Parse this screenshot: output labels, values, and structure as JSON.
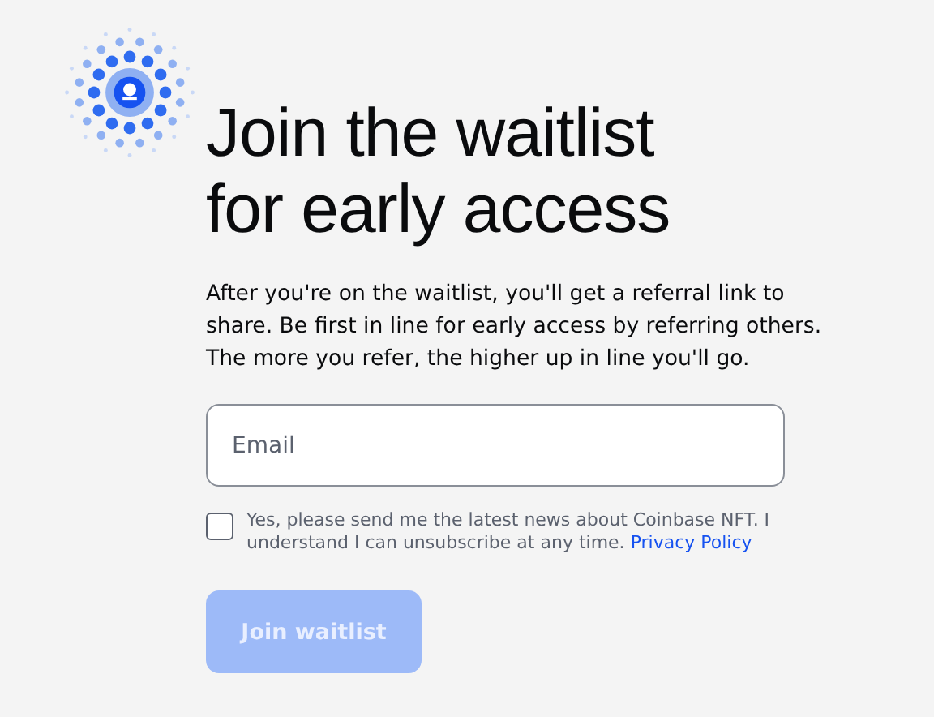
{
  "title_lines": [
    "Join the waitlist",
    "for early access"
  ],
  "description": "After you're on the waitlist, you'll get a referral link to share. Be first in line for early access by referring others. The more you refer, the higher up in line you'll go.",
  "email": {
    "placeholder": "Email"
  },
  "consent": {
    "checked": false,
    "text": "Yes, please send me the latest news about Coinbase NFT. I understand I can unsubscribe at any time.",
    "link": "Privacy Policy"
  },
  "submit": {
    "label": "Join waitlist",
    "disabled": true
  }
}
